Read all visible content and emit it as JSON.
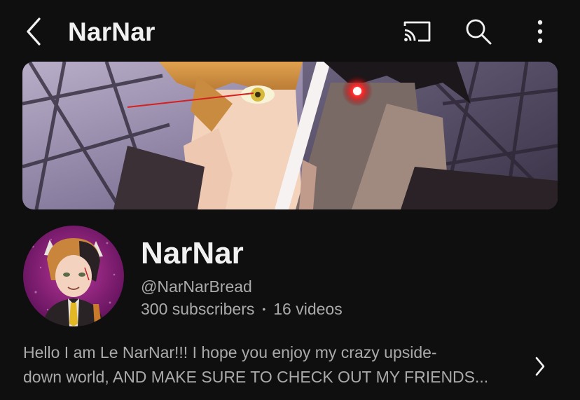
{
  "header": {
    "title": "NarNar",
    "icons": {
      "back": "back-chevron-icon",
      "cast": "cast-icon",
      "search": "search-icon",
      "more": "more-vertical-icon"
    }
  },
  "channel": {
    "name": "NarNar",
    "handle": "@NarNarBread",
    "subscribers": "300 subscribers",
    "separator": "•",
    "videos": "16 videos",
    "description_line1": "Hello I am Le NarNar!!! I hope you enjoy my crazy upside-",
    "description_line2": "down world, AND MAKE SURE TO CHECK OUT MY FRIENDS..."
  },
  "colors": {
    "background": "#0f0f0f",
    "primary_text": "#f1f1f1",
    "secondary_text": "#aaaaaa"
  }
}
